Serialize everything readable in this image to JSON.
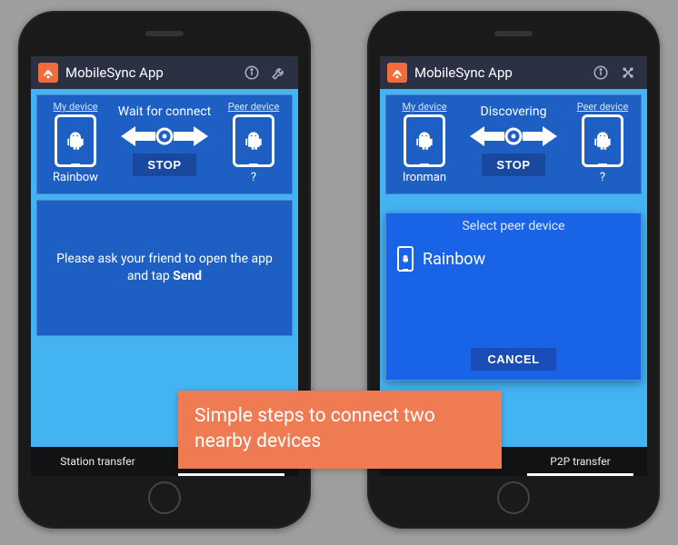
{
  "app_title": "MobileSync App",
  "phones": [
    {
      "my_device_label": "My device",
      "peer_device_label": "Peer device",
      "status": "Wait for connect",
      "stop_label": "STOP",
      "my_device_name": "Rainbow",
      "peer_device_name": "?",
      "message_pre": "Please ask your friend to open the app and tap ",
      "message_bold": "Send"
    },
    {
      "my_device_label": "My device",
      "peer_device_label": "Peer device",
      "status": "Discovering",
      "stop_label": "STOP",
      "my_device_name": "Ironman",
      "peer_device_name": "?",
      "dialog": {
        "title": "Select peer device",
        "peer_name": "Rainbow",
        "cancel_label": "CANCEL"
      }
    }
  ],
  "tabs": {
    "station": "Station transfer",
    "p2p": "P2P transfer"
  },
  "banner": "Simple steps to connect two nearby devices",
  "icons": {
    "app": "app-icon",
    "info": "info-icon",
    "wrench": "wrench-icon",
    "settings": "settings-cross-icon",
    "android": "android-icon",
    "phone": "phone-icon"
  }
}
